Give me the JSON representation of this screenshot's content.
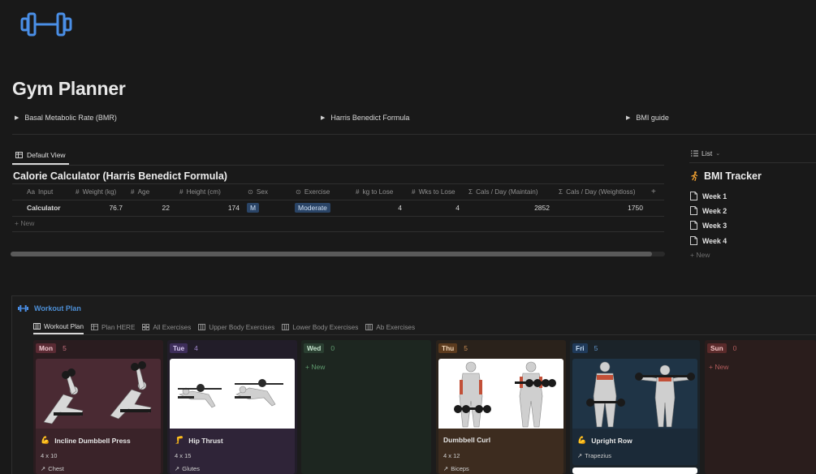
{
  "page": {
    "title": "Gym Planner",
    "logo_icon": "dumbbell-icon",
    "accent": "#4a8fe7"
  },
  "toggles": [
    {
      "label": "Basal Metabolic Rate (BMR)"
    },
    {
      "label": "Harris Benedict Formula"
    },
    {
      "label": "BMI guide"
    }
  ],
  "calorie_db": {
    "view_tab": "Default View",
    "title": "Calorie Calculator (Harris Benedict Formula)",
    "columns": [
      {
        "sym": "Aa",
        "label": "Input"
      },
      {
        "sym": "#",
        "label": "Weight (kg)"
      },
      {
        "sym": "#",
        "label": "Age"
      },
      {
        "sym": "#",
        "label": "Height (cm)"
      },
      {
        "sym": "⊙",
        "label": "Sex"
      },
      {
        "sym": "⊙",
        "label": "Exercise"
      },
      {
        "sym": "#",
        "label": "kg to Lose"
      },
      {
        "sym": "#",
        "label": "Wks to Lose"
      },
      {
        "sym": "Σ",
        "label": "Cals / Day (Maintain)"
      },
      {
        "sym": "Σ",
        "label": "Cals / Day (Weightloss)"
      }
    ],
    "add_column": "+",
    "row": {
      "input": "Calculator",
      "weight": "76.7",
      "age": "22",
      "height": "174",
      "sex": "M",
      "exercise": "Moderate",
      "kg_to_lose": "4",
      "wks_to_lose": "4",
      "cals_maintain": "2852",
      "cals_weightloss": "1750"
    },
    "new_label": "+ New",
    "scroll_fraction": 0.98
  },
  "bmi": {
    "list_tab": "List",
    "title": "BMI Tracker",
    "title_icon": "runner-icon",
    "items": [
      "Week 1",
      "Week 2",
      "Week 3",
      "Week 4"
    ],
    "new_label": "+ New"
  },
  "workout": {
    "title": "Workout Plan",
    "tabs": [
      "Workout Plan",
      "Plan HERE",
      "All Exercises",
      "Upper Body Exercises",
      "Lower Body Exercises",
      "Ab Exercises"
    ],
    "columns": [
      {
        "day": "Mon",
        "count": "5",
        "tag_bg": "#5a2a33",
        "tag_fg": "#f0c8cf",
        "count_fg": "#c9707f",
        "col_bg": "#2a1c1f"
      },
      {
        "day": "Tue",
        "count": "4",
        "tag_bg": "#3d2d5a",
        "tag_fg": "#d9cbf2",
        "count_fg": "#9f86cc",
        "col_bg": "#221d29"
      },
      {
        "day": "Wed",
        "count": "0",
        "tag_bg": "#2a3f31",
        "tag_fg": "#c4e3cc",
        "count_fg": "#5f9a6e",
        "col_bg": "#1d2620"
      },
      {
        "day": "Thu",
        "count": "5",
        "tag_bg": "#5c3b1e",
        "tag_fg": "#f2d6b8",
        "count_fg": "#c98a52",
        "col_bg": "#2a221b"
      },
      {
        "day": "Fri",
        "count": "5",
        "tag_bg": "#1f3a5a",
        "tag_fg": "#c4dbf2",
        "count_fg": "#5f93c9",
        "col_bg": "#1b2329"
      },
      {
        "day": "Sun",
        "count": "0",
        "tag_bg": "#5a2a2a",
        "tag_fg": "#f2c4c4",
        "count_fg": "#b35c5c",
        "col_bg": "#2a1d1c"
      }
    ],
    "cards": {
      "mon": {
        "name": "Incline Dumbbell Press",
        "sets": "4 x 10",
        "muscle": "Chest"
      },
      "tue": {
        "name": "Hip Thrust",
        "sets": "4 x 15",
        "muscle": "Glutes"
      },
      "thu": {
        "name": "Dumbbell Curl",
        "sets": "4 x 12",
        "muscle": "Biceps"
      },
      "fri": {
        "name": "Upright Row",
        "sets": "",
        "muscle": "Trapezius"
      }
    },
    "new_label": "+ New"
  }
}
